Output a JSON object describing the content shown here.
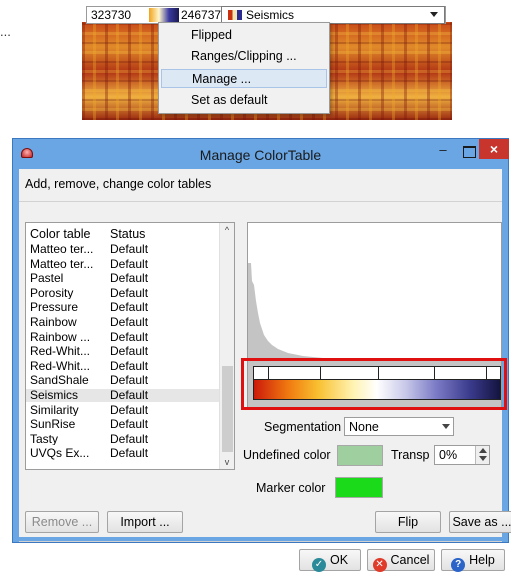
{
  "top": {
    "ellipsis": "...",
    "min_value": "323730",
    "max_value": "246737",
    "colortable_name": "Seismics",
    "menu": [
      "Flipped",
      "Ranges/Clipping ...",
      "Manage ...",
      "Set as default"
    ],
    "highlighted_item": "Manage ..."
  },
  "dialog": {
    "title": "Manage ColorTable",
    "subtitle": "Add, remove, change color tables",
    "list": {
      "headers": [
        "Color table",
        "Status"
      ],
      "rows": [
        [
          "Matteo ter...",
          "Default"
        ],
        [
          "Matteo ter...",
          "Default"
        ],
        [
          "Pastel",
          "Default"
        ],
        [
          "Porosity",
          "Default"
        ],
        [
          "Pressure",
          "Default"
        ],
        [
          "Rainbow",
          "Default"
        ],
        [
          "Rainbow ...",
          "Default"
        ],
        [
          "Red-Whit...",
          "Default"
        ],
        [
          "Red-Whit...",
          "Default"
        ],
        [
          "SandShale",
          "Default"
        ],
        [
          "Seismics",
          "Default"
        ],
        [
          "Similarity",
          "Default"
        ],
        [
          "SunRise",
          "Default"
        ],
        [
          "Tasty",
          "Default"
        ],
        [
          "UVQs Ex...",
          "Default"
        ]
      ],
      "selected": "Seismics"
    },
    "segmentation_label": "Segmentation",
    "segmentation_value": "None",
    "undefined_color_label": "Undefined color",
    "undefined_color": "#9fce9f",
    "transp_label": "Transp",
    "transp_value": "0%",
    "marker_color_label": "Marker color",
    "marker_color": "#1ada1a",
    "buttons": {
      "remove": "Remove ...",
      "import": "Import ...",
      "flip": "Flip",
      "save_as": "Save as ...",
      "ok": "OK",
      "cancel": "Cancel",
      "help": "Help"
    },
    "window_controls": {
      "minimize": "–",
      "close": "×"
    }
  },
  "colors": {
    "titlebar": "#6aa6e4",
    "highlight_frame": "#e01010",
    "close_button": "#c7352c"
  }
}
